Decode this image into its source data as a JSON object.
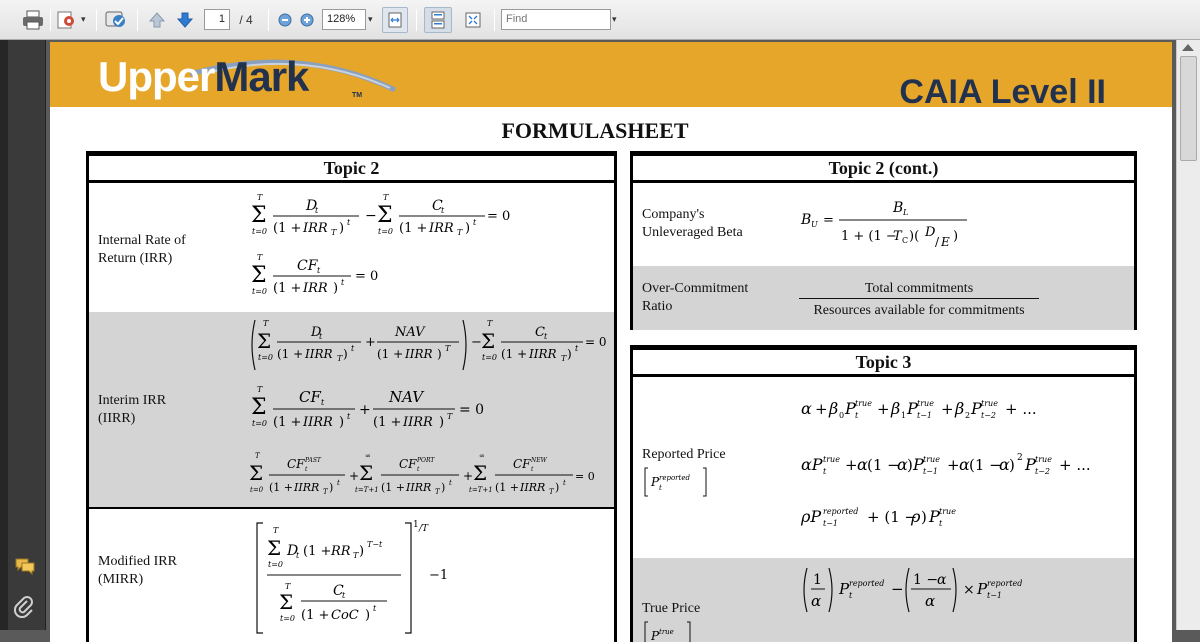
{
  "toolbar": {
    "page_current": "1",
    "page_total": "/ 4",
    "zoom": "128%",
    "find_placeholder": "Find"
  },
  "document": {
    "logo_upper": "Upper",
    "logo_mark": "Mark",
    "logo_tm": "TM",
    "level": "CAIA Level II",
    "title": "FORMULASHEET",
    "left_table": {
      "header": "Topic 2",
      "rows": [
        {
          "label_line1": "Internal Rate of",
          "label_line2": "Return (IRR)"
        },
        {
          "label_line1": "Interim IRR",
          "label_line2": "(IIRR)"
        },
        {
          "label_line1": "Modified IRR",
          "label_line2": "(MIRR)"
        }
      ]
    },
    "right_table_1": {
      "header": "Topic 2 (cont.)",
      "rows": [
        {
          "label_line1": "Company's",
          "label_line2": "Unleveraged Beta"
        },
        {
          "label_line1": "Over-Commitment",
          "label_line2": "Ratio",
          "numerator": "Total commitments",
          "denominator": "Resources available for commitments"
        }
      ]
    },
    "right_table_2": {
      "header": "Topic 3",
      "rows": [
        {
          "label_line1": "Reported Price"
        },
        {
          "label_line1": "True Price"
        }
      ]
    }
  },
  "colors": {
    "banner": "#e5a62a",
    "brand_navy": "#22324e",
    "row_gray": "#d4d4d4"
  }
}
